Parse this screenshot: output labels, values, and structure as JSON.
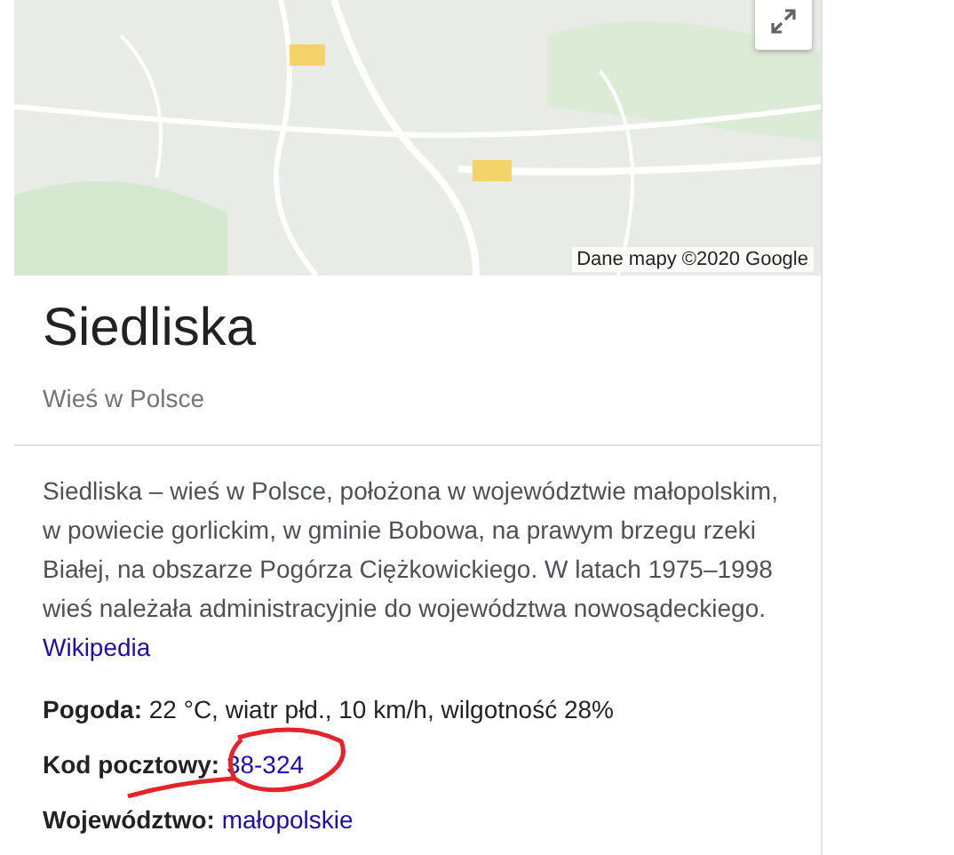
{
  "map": {
    "kind": "picture",
    "attribution": "Dane mapy ©2020 Google"
  },
  "title": "Siedliska",
  "subtitle": "Wieś w Polsce",
  "description": {
    "text": "Siedliska – wieś w Polsce, położona w województwie małopolskim, w powiecie gorlickim, w gminie Bobowa, na prawym brzegu rzeki Białej, na obszarze Pogórza Ciężkowickiego. W latach 1975–1998 wieś należała administracyjnie do województwa nowosądeckiego.",
    "link": "Wikipedia"
  },
  "facts": [
    {
      "label": "Pogoda:",
      "value": "22 °C, wiatr płd., 10 km/h, wilgotność 28%",
      "kind": "text"
    },
    {
      "label": "Kod pocztowy:",
      "value": "38-324",
      "kind": "link"
    },
    {
      "label": "Województwo:",
      "value": "małopolskie",
      "kind": "link"
    }
  ]
}
